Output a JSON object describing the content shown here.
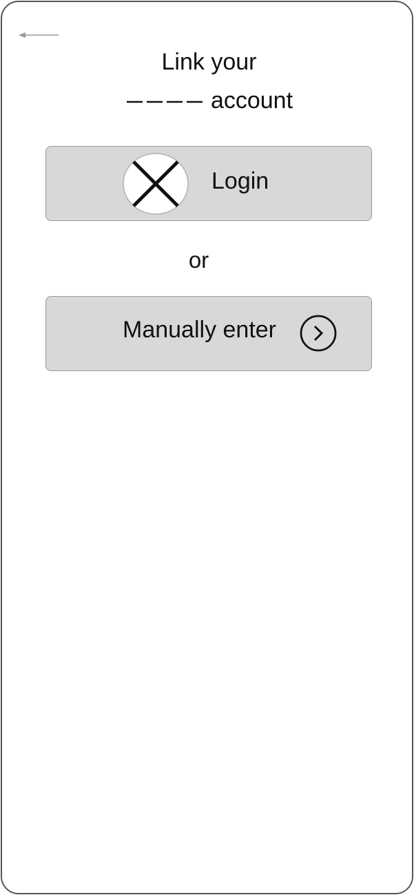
{
  "header": {
    "back_icon": "arrow-left-icon",
    "title_line1": "Link your",
    "title_placeholder": "————",
    "title_line2_suffix": "account"
  },
  "login_option": {
    "logo_icon": "image-placeholder-icon",
    "label": "Login"
  },
  "divider": {
    "label": "or"
  },
  "manual_option": {
    "label": "Manually enter",
    "chevron_icon": "chevron-right-circle-icon"
  },
  "colors": {
    "button_fill": "#d8d8d8",
    "button_border": "#9a9a9a",
    "frame_border": "#555555",
    "text": "#111111",
    "back_arrow": "#999999"
  }
}
